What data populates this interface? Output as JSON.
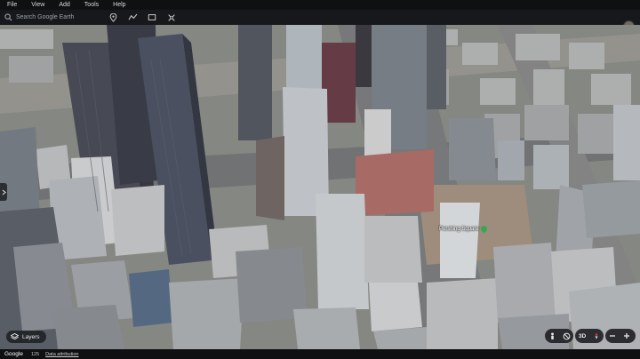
{
  "menu": {
    "items": [
      "File",
      "View",
      "Add",
      "Tools",
      "Help"
    ]
  },
  "search": {
    "placeholder": "Search Google Earth"
  },
  "toolbar_icons": [
    "pin-icon",
    "path-icon",
    "polygon-icon",
    "measure-icon"
  ],
  "map": {
    "poi_label": "Pershing Square",
    "poi_color": "#34a853"
  },
  "layers": {
    "label": "Layers"
  },
  "controls": {
    "view_mode": "3D"
  },
  "status": {
    "brand": "Google",
    "scale": "125",
    "attribution": "Data attribution"
  },
  "colors": {
    "accent": "#34a853",
    "chrome_bg": "#16181b"
  }
}
